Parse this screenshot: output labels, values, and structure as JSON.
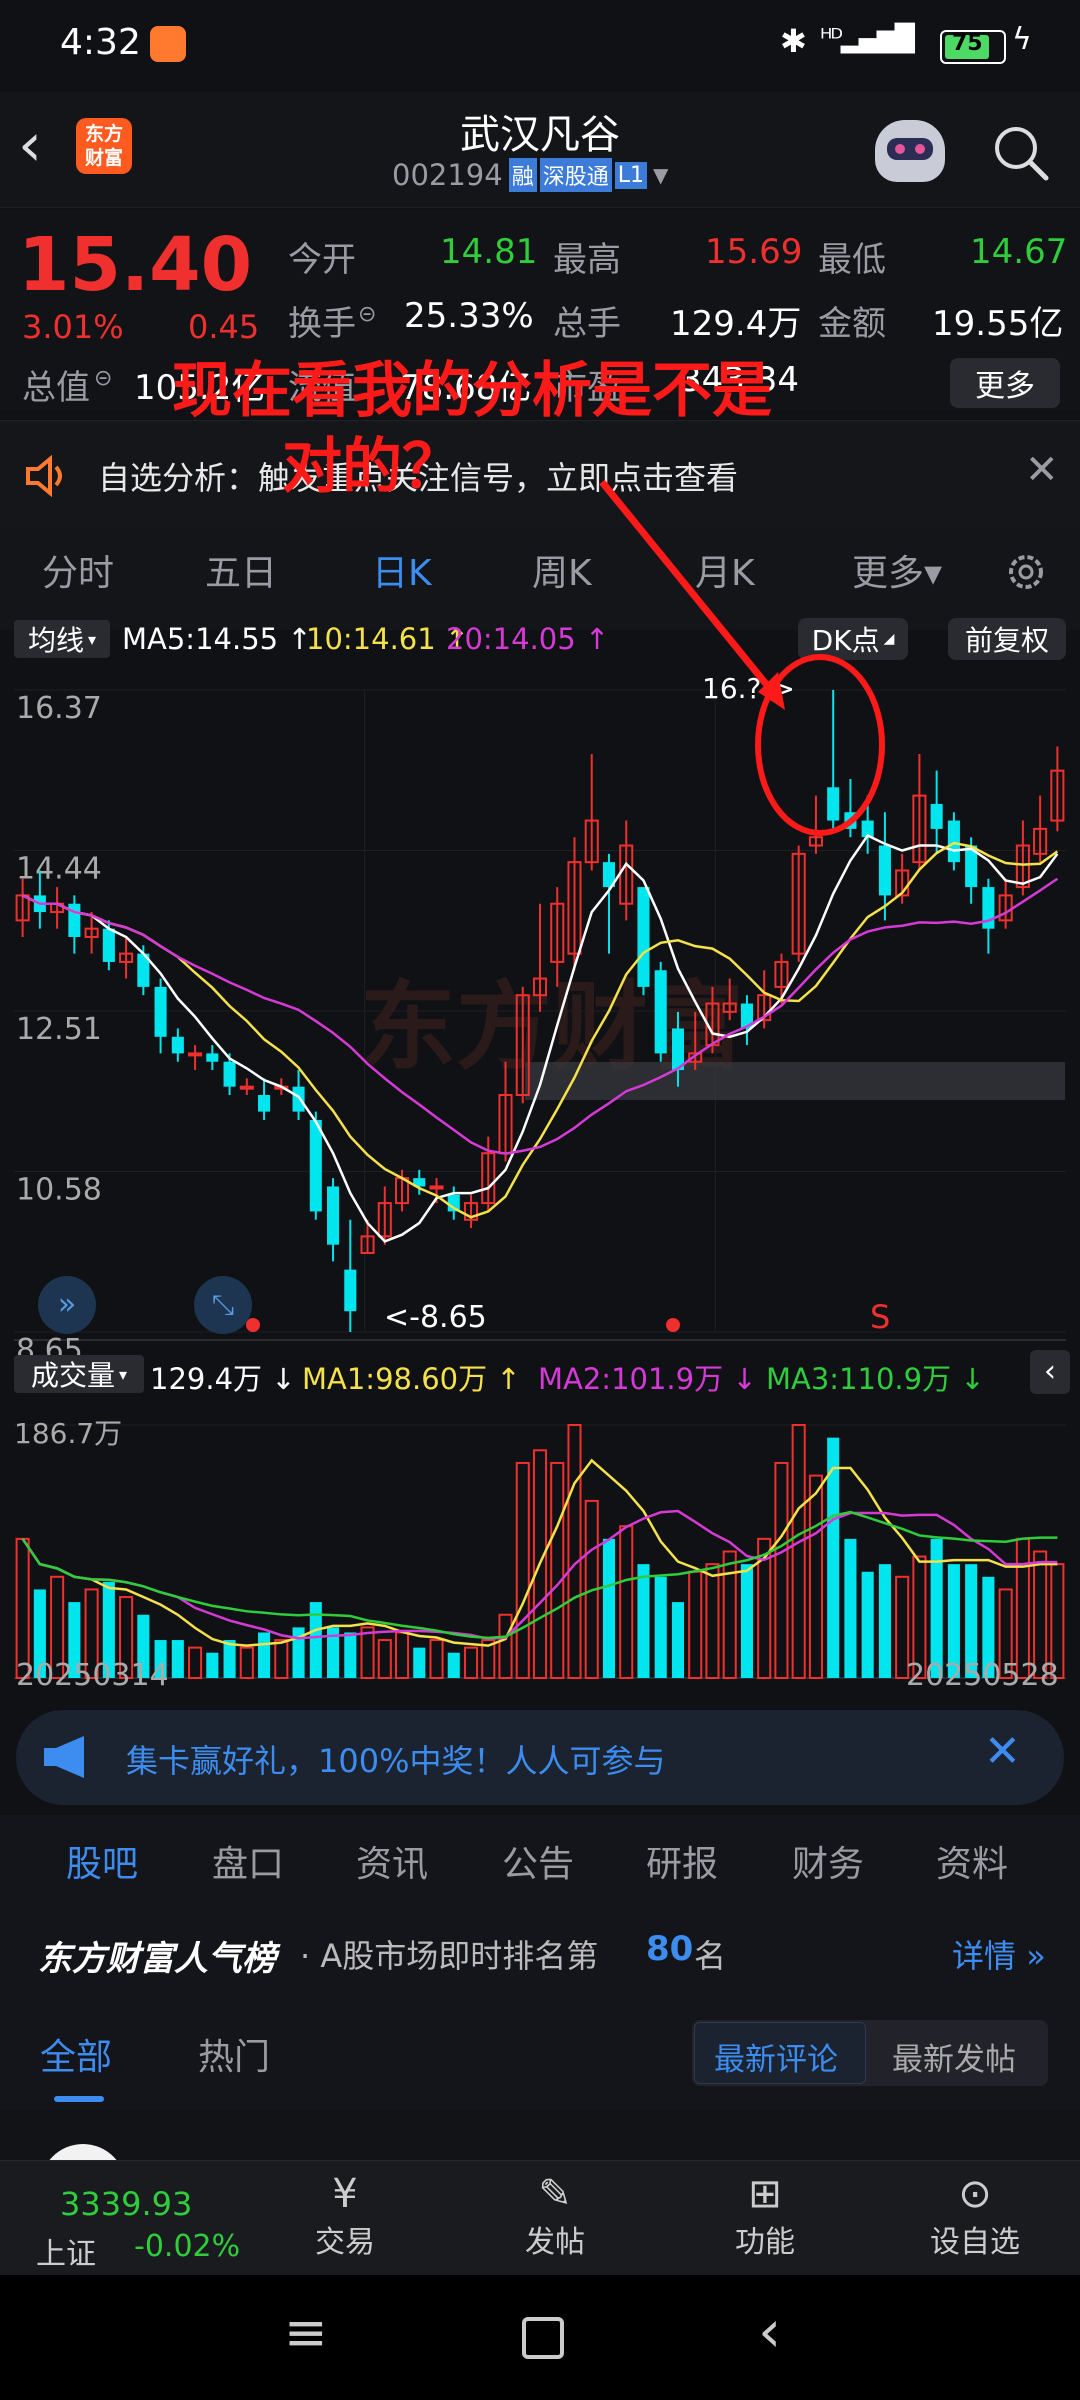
{
  "status": {
    "time": "4:32",
    "battery": "75"
  },
  "header": {
    "title": "武汉凡谷",
    "code": "002194",
    "badge_margin": "融",
    "badge_connect": "深股通",
    "badge_level": "L1",
    "app_logo": "东方财富"
  },
  "quote": {
    "price": "15.40",
    "change_pct": "3.01%",
    "change_amt": "0.45",
    "open_label": "今开",
    "open": "14.81",
    "high_label": "最高",
    "high": "15.69",
    "low_label": "最低",
    "low": "14.67",
    "turnover_label": "换手",
    "turnover": "25.33%",
    "volume_label": "总手",
    "volume": "129.4万",
    "amount_label": "金额",
    "amount": "19.55亿",
    "mktcap_label": "总值",
    "mktcap": "105.2亿",
    "float_label": "流值",
    "float": "78.68亿",
    "pe_label": "市盈",
    "pe": "343.34",
    "more_button": "更多"
  },
  "annotation": {
    "line1": "现在看我的分析是不是",
    "line2": "对的？",
    "color": "#ff1a1a"
  },
  "alert": {
    "text": "自选分析：触发重点关注信号，立即点击查看"
  },
  "period_tabs": [
    "分时",
    "五日",
    "日K",
    "周K",
    "月K",
    "更多▾"
  ],
  "kline": {
    "ma_selector": "均线",
    "ma5": "MA5:14.55 ↑",
    "ma10": "10:14.61 ↑",
    "ma20": "20:14.05 ↑",
    "dk_button": "DK点",
    "adjust_button": "前复权",
    "y_ticks": [
      "16.37",
      "14.44",
      "12.51",
      "10.58",
      "8.65"
    ],
    "low_marker": "<-8.65",
    "high_marker": "16.?->",
    "signal_s": "S",
    "watermark": "东方财富"
  },
  "volume": {
    "selector": "成交量",
    "value": "129.4万 ↓",
    "ma1": "MA1:98.60万 ↑",
    "ma2": "MA2:101.9万 ↓",
    "ma3": "MA3:110.9万 ↓",
    "y_max": "186.7万",
    "date_start": "20250314",
    "date_end": "20250528"
  },
  "ad": {
    "text": "集卡赢好礼，100%中奖！人人可参与"
  },
  "info_tabs": [
    "股吧",
    "盘口",
    "资讯",
    "公告",
    "研报",
    "财务",
    "资料"
  ],
  "rank": {
    "brand": "东方财富人气榜",
    "text_prefix": "· A股市场即时排名第",
    "rank_no": "80",
    "text_suffix": "名",
    "detail": "详情"
  },
  "feed": {
    "tabs": [
      "全部",
      "热门"
    ],
    "sort_buttons": [
      "最新评论",
      "最新发帖"
    ]
  },
  "bottom": {
    "index_value": "3339.93",
    "index_name": "上证",
    "index_change": "-0.02%",
    "items": [
      "交易",
      "发帖",
      "功能",
      "设自选"
    ]
  },
  "colors": {
    "up": "#f0302e",
    "down": "#00e5ee",
    "ma5": "#ffffff",
    "ma10": "#f5e14a",
    "ma20": "#d63ad6",
    "blue_accent": "#3d8cf0"
  }
}
